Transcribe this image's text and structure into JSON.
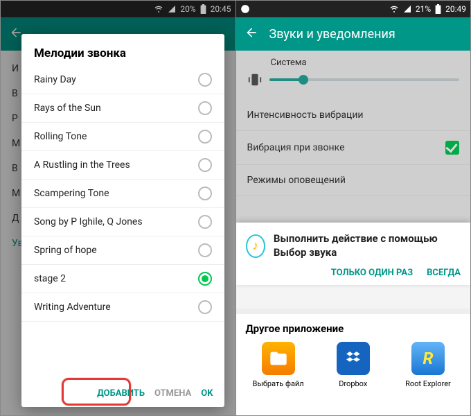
{
  "left": {
    "status": {
      "battery": "20%",
      "time": "20:45"
    },
    "bg_items": [
      "И",
      "B",
      "P",
      "M",
      "B",
      "M",
      "Д",
      "Уведомление"
    ],
    "dialog": {
      "title": "Мелодии звонка",
      "items": [
        {
          "label": "Rainy Day",
          "selected": false
        },
        {
          "label": "Rays of the Sun",
          "selected": false
        },
        {
          "label": "Rolling Tone",
          "selected": false
        },
        {
          "label": "A Rustling in the Trees",
          "selected": false
        },
        {
          "label": "Scampering Tone",
          "selected": false
        },
        {
          "label": "Song by P Ighile, Q Jones",
          "selected": false
        },
        {
          "label": "Spring of hope",
          "selected": false
        },
        {
          "label": "stage 2",
          "selected": true
        },
        {
          "label": "Writing Adventure",
          "selected": false
        }
      ],
      "actions": {
        "add": "ДОБАВИТЬ",
        "cancel": "ОТМЕНА",
        "ok": "OK"
      }
    }
  },
  "right": {
    "status": {
      "battery": "21%",
      "time": "20:49"
    },
    "title": "Звуки и уведомления",
    "system_label": "Система",
    "rows": {
      "vibration_intensity": "Интенсивность вибрации",
      "vibrate_on_call": "Вибрация при звонке",
      "notification_modes": "Режимы оповещений"
    },
    "chooser": {
      "text": "Выполнить действие с помощью Выбор звука",
      "once": "ТОЛЬКО ОДИН РАЗ",
      "always": "ВСЕГДА"
    },
    "other": {
      "title": "Другое приложение",
      "apps": [
        {
          "label": "Выбрать файл"
        },
        {
          "label": "Dropbox"
        },
        {
          "label": "Root Explorer"
        }
      ]
    }
  }
}
